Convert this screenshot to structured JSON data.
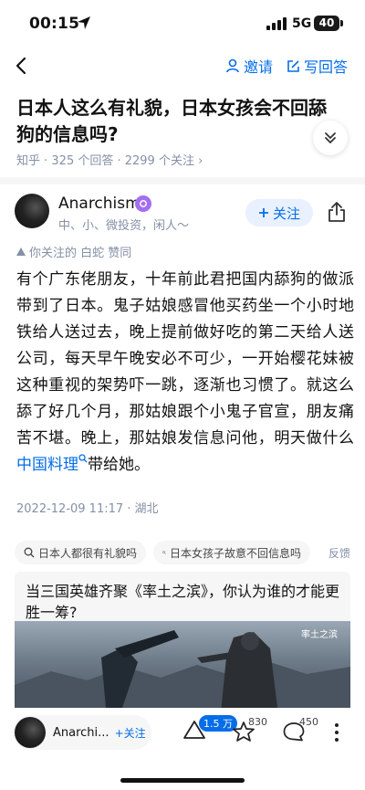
{
  "status": {
    "time": "00:15",
    "network": "5G",
    "battery": "40"
  },
  "nav": {
    "invite_label": "邀请",
    "write_label": "写回答"
  },
  "question": {
    "title": "日本人这么有礼貌，日本女孩会不回舔狗的信息吗?",
    "meta": "知乎 · 325 个回答 · 2299 个关注 ›"
  },
  "answer": {
    "author": "Anarchism",
    "bio": "中、小、微投资，闲人～",
    "follow_label": "关注",
    "liked_by": "你关注的 白蛇 赞同",
    "content_before": "有个广东佬朋友，十年前此君把国内舔狗的做派带到了日本。鬼子姑娘感冒他买药坐一个小时地铁给人送过去，晚上提前做好吃的第二天给人送公司，每天早午晚安必不可少，一开始樱花妹被这种重视的架势吓一跳，逐渐也习惯了。就这么舔了好几个月，那姑娘跟个小鬼子官宣，朋友痛苦不堪。晚上，那姑娘发信息问他，明天做什么",
    "keyword": "中国料理",
    "content_after": "带给她。",
    "date": "2022-12-09 11:17 · 湖北"
  },
  "chips": [
    "日本人都很有礼貌吗",
    "日本女孩子故意不回信息吗"
  ],
  "feedback_label": "反馈",
  "promo": {
    "title": "当三国英雄齐聚《率土之滨》，你认为谁的才能更胜一筹?",
    "logo_text": "率土之滨"
  },
  "bottom": {
    "author": "Anarchi...",
    "follow_label": "+关注",
    "vote_count": "1.5 万",
    "fav_count": "830",
    "comment_count": "450"
  },
  "colors": {
    "accent": "#056de8",
    "muted": "#8590a6",
    "badge": "#a46ef0"
  }
}
